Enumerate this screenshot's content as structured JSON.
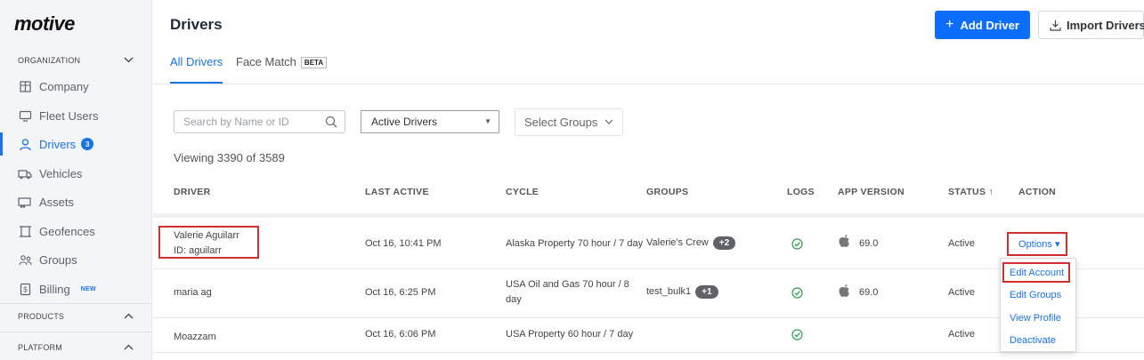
{
  "brand": {
    "logo_text": "motive"
  },
  "sidebar": {
    "section_organization": "ORGANIZATION",
    "items": [
      {
        "label": "Company",
        "icon": "building-icon"
      },
      {
        "label": "Fleet Users",
        "icon": "monitor-icon"
      },
      {
        "label": "Drivers",
        "icon": "person-icon",
        "badge": "3",
        "active": true
      },
      {
        "label": "Vehicles",
        "icon": "truck-icon"
      },
      {
        "label": "Assets",
        "icon": "trailer-icon"
      },
      {
        "label": "Geofences",
        "icon": "geofence-icon"
      },
      {
        "label": "Groups",
        "icon": "groups-icon"
      },
      {
        "label": "Billing",
        "icon": "billing-icon",
        "badge_new": "NEW"
      }
    ],
    "section_products": "PRODUCTS",
    "section_platform": "PLATFORM"
  },
  "header": {
    "title": "Drivers",
    "add_button": "Add Driver",
    "import_button": "Import Drivers"
  },
  "tabs": [
    {
      "label": "All Drivers",
      "active": true
    },
    {
      "label": "Face Match",
      "badge": "BETA"
    }
  ],
  "filters": {
    "search_placeholder": "Search by Name or ID",
    "status_select": "Active Drivers",
    "groups_select": "Select Groups"
  },
  "viewing_text": "Viewing 3390 of 3589",
  "table": {
    "columns": [
      "DRIVER",
      "LAST ACTIVE",
      "CYCLE",
      "GROUPS",
      "LOGS",
      "APP VERSION",
      "STATUS ↑",
      "ACTION"
    ],
    "rows": [
      {
        "name": "Valerie Aguilarr",
        "id": "ID: aguilarr",
        "last_active": "Oct 16, 10:41 PM",
        "cycle": "Alaska Property 70 hour / 7 day",
        "group": "Valerie's Crew",
        "group_more": "+2",
        "logs_ok": true,
        "app_icon": "apple-icon",
        "app_version": "69.0",
        "status": "Active",
        "action": "Options ▾"
      },
      {
        "name": "maria ag",
        "last_active": "Oct 16, 6:25 PM",
        "cycle": "USA Oil and Gas 70 hour / 8 day",
        "group": "test_bulk1",
        "group_more": "+1",
        "logs_ok": true,
        "app_icon": "apple-icon",
        "app_version": "69.0",
        "status": "Active"
      },
      {
        "name": "Moazzam",
        "last_active": "Oct 16, 6:06 PM",
        "cycle": "USA Property 60 hour / 7 day",
        "logs_ok": true,
        "status": "Active"
      }
    ]
  },
  "options_menu": [
    "Edit Account",
    "Edit Groups",
    "View Profile",
    "Deactivate"
  ],
  "colors": {
    "accent": "#1a73e8",
    "primary_button": "#0d6efd",
    "highlight": "#d32f2f",
    "success": "#2e9e4f"
  }
}
